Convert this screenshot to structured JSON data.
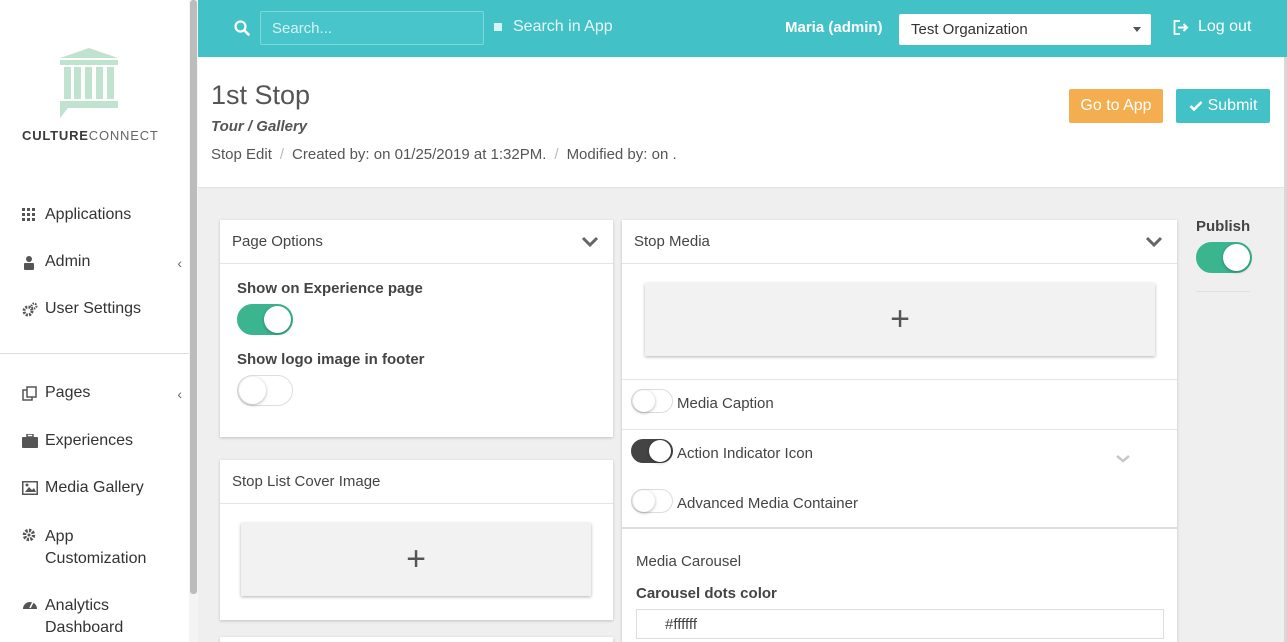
{
  "sidebar": {
    "logo": {
      "strong": "CULTURE",
      "light": "CONNECT"
    },
    "items": [
      {
        "label": "Applications",
        "icon": "grid-icon"
      },
      {
        "label": "Admin",
        "icon": "user-lock-icon",
        "chevron": "‹"
      },
      {
        "label": "User Settings",
        "icon": "gears-icon"
      },
      {
        "label": "Pages",
        "icon": "copy-icon",
        "chevron": "‹"
      },
      {
        "label": "Experiences",
        "icon": "briefcase-icon"
      },
      {
        "label": "Media Gallery",
        "icon": "image-icon"
      },
      {
        "label": "App Customization",
        "icon": "gear-icon"
      },
      {
        "label": "Analytics Dashboard",
        "icon": "dashboard-icon"
      }
    ]
  },
  "topbar": {
    "search_placeholder": "Search...",
    "search_in_app_label": "Search in App",
    "user": "Maria (admin)",
    "organization": "Test Organization",
    "logout_label": "Log out"
  },
  "header": {
    "title": "1st Stop",
    "subtitle": "Tour / Gallery",
    "breadcrumb": [
      "Stop Edit",
      "Created by: on 01/25/2019 at 1:32PM.",
      "Modified by: on ."
    ],
    "go_to_app_label": "Go to App",
    "submit_label": "Submit"
  },
  "page_options": {
    "title": "Page Options",
    "show_on_experience_label": "Show on Experience page",
    "show_on_experience_on": true,
    "show_logo_footer_label": "Show logo image in footer",
    "show_logo_footer_on": false
  },
  "cover_image": {
    "title": "Stop List Cover Image",
    "add_symbol": "+"
  },
  "stop_media": {
    "title": "Stop Media",
    "add_symbol": "+",
    "media_caption_label": "Media Caption",
    "media_caption_on": false,
    "action_indicator_label": "Action Indicator Icon",
    "action_indicator_on": true,
    "advanced_container_label": "Advanced Media Container",
    "advanced_container_on": false,
    "carousel_title": "Media Carousel",
    "carousel_dots_label": "Carousel dots color",
    "carousel_dots_value": "#ffffff"
  },
  "publish": {
    "label": "Publish",
    "on": true
  },
  "colors": {
    "topbar": "#42c1c6",
    "toggle_on": "#3bb58d",
    "go_to_app": "#f4ad4f",
    "submit": "#42c1c6"
  }
}
